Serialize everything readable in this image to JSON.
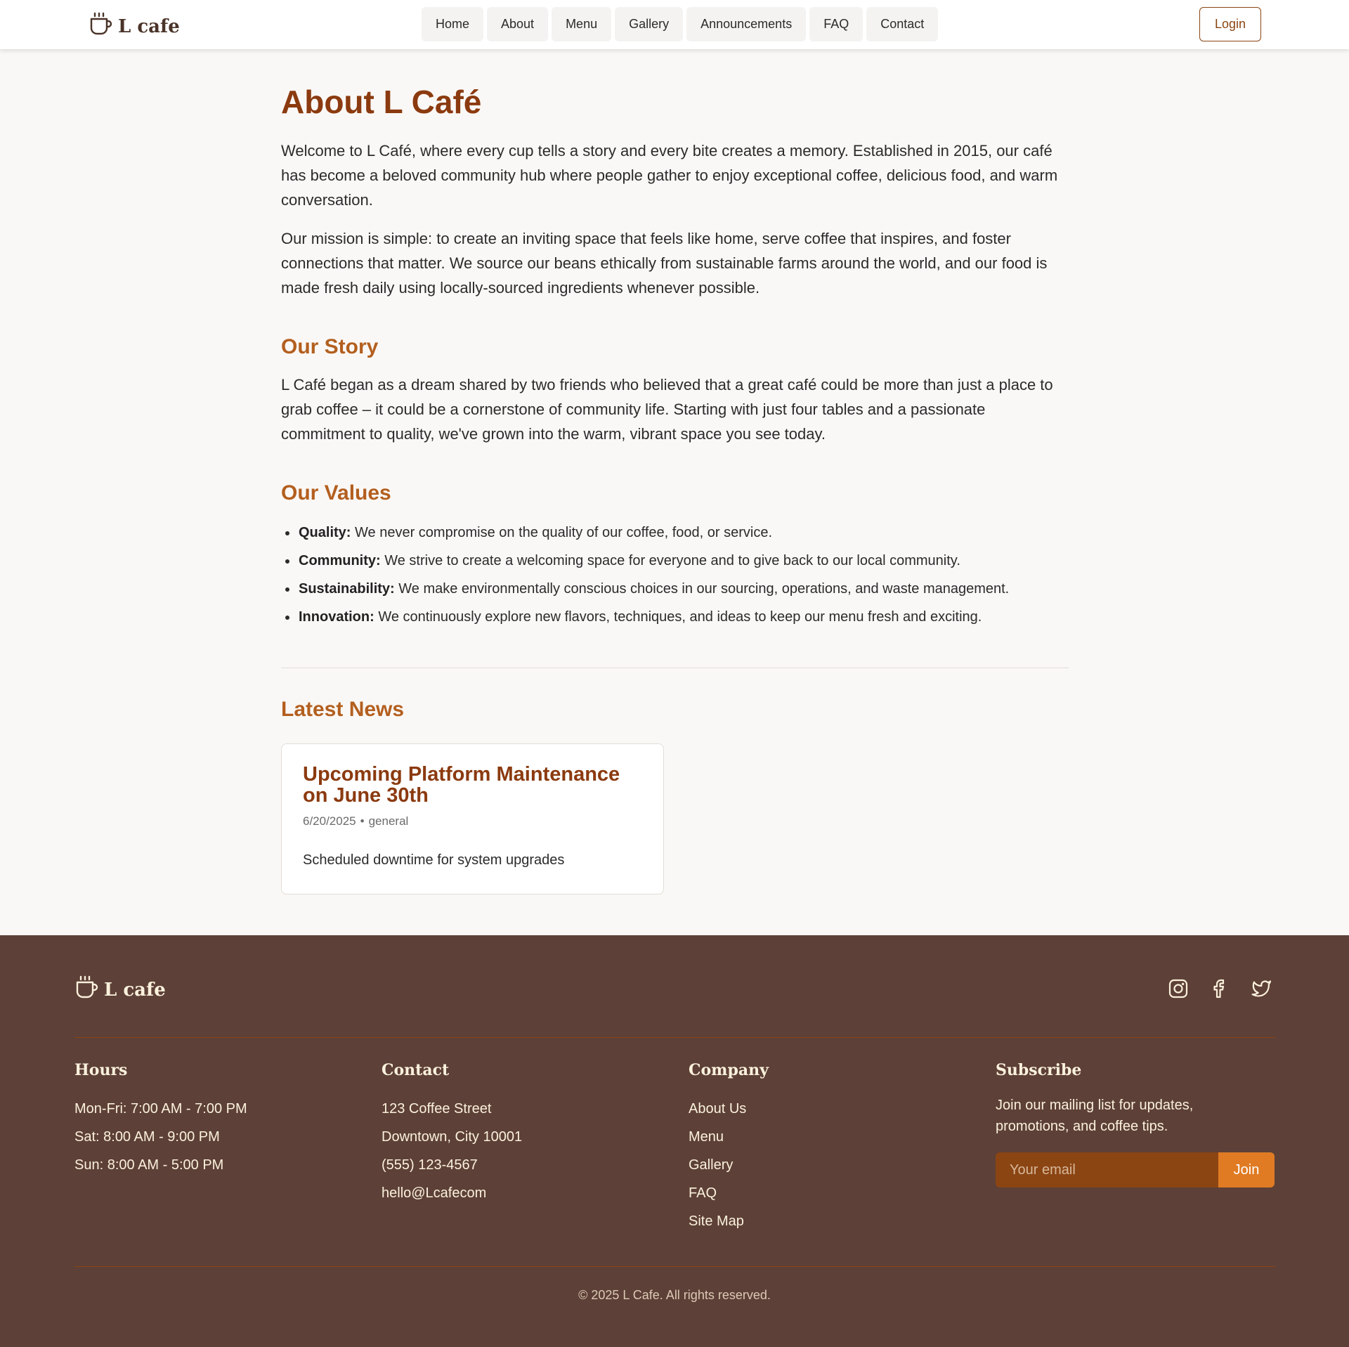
{
  "brand": {
    "name": "L cafe"
  },
  "nav": {
    "items": [
      {
        "label": "Home"
      },
      {
        "label": "About"
      },
      {
        "label": "Menu"
      },
      {
        "label": "Gallery"
      },
      {
        "label": "Announcements"
      },
      {
        "label": "FAQ"
      },
      {
        "label": "Contact"
      }
    ],
    "login_label": "Login"
  },
  "about": {
    "title": "About L Café",
    "intro": "Welcome to L Café, where every cup tells a story and every bite creates a memory. Established in 2015, our café has become a beloved community hub where people gather to enjoy exceptional coffee, delicious food, and warm conversation.",
    "mission": "Our mission is simple: to create an inviting space that feels like home, serve coffee that inspires, and foster connections that matter. We source our beans ethically from sustainable farms around the world, and our food is made fresh daily using locally-sourced ingredients whenever possible.",
    "story_heading": "Our Story",
    "story_text": "L Café began as a dream shared by two friends who believed that a great café could be more than just a place to grab coffee – it could be a cornerstone of community life. Starting with just four tables and a passionate commitment to quality, we've grown into the warm, vibrant space you see today.",
    "values_heading": "Our Values",
    "values": [
      {
        "name": "Quality:",
        "text": " We never compromise on the quality of our coffee, food, or service."
      },
      {
        "name": "Community:",
        "text": " We strive to create a welcoming space for everyone and to give back to our local community."
      },
      {
        "name": "Sustainability:",
        "text": " We make environmentally conscious choices in our sourcing, operations, and waste management."
      },
      {
        "name": "Innovation:",
        "text": " We continuously explore new flavors, techniques, and ideas to keep our menu fresh and exciting."
      }
    ]
  },
  "news": {
    "heading": "Latest News",
    "items": [
      {
        "title": "Upcoming Platform Maintenance on June 30th",
        "date": "6/20/2025",
        "separator": "•",
        "category": "general",
        "description": "Scheduled downtime for system upgrades"
      }
    ]
  },
  "footer": {
    "socials": [
      "instagram-icon",
      "facebook-icon",
      "twitter-icon"
    ],
    "hours": {
      "heading": "Hours",
      "lines": [
        "Mon-Fri: 7:00 AM - 7:00 PM",
        "Sat: 8:00 AM - 9:00 PM",
        "Sun: 8:00 AM - 5:00 PM"
      ]
    },
    "contact": {
      "heading": "Contact",
      "lines": [
        "123 Coffee Street",
        "Downtown, City 10001",
        "(555) 123-4567",
        "hello@Lcafecom"
      ]
    },
    "company": {
      "heading": "Company",
      "links": [
        "About Us",
        "Menu",
        "Gallery",
        "FAQ",
        "Site Map"
      ]
    },
    "subscribe": {
      "heading": "Subscribe",
      "text": "Join our mailing list for updates, promotions, and coffee tips.",
      "placeholder": "Your email",
      "button": "Join"
    },
    "copyright": "© 2025 L Cafe. All rights reserved."
  },
  "colors": {
    "accent": "#8b3a0f",
    "section_heading": "#b35f1f",
    "footer_bg": "#5d4037",
    "join_button": "#e07b24"
  }
}
